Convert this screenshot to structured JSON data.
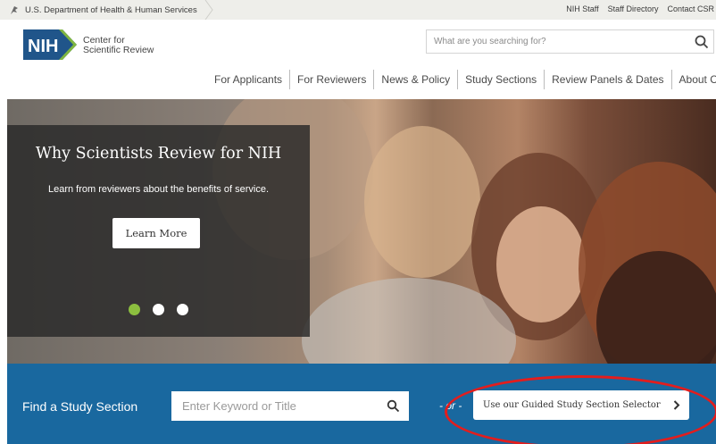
{
  "topbar": {
    "hhs_label": "U.S. Department of Health & Human Services",
    "links": [
      "NIH Staff",
      "Staff Directory",
      "Contact CSR"
    ]
  },
  "header": {
    "logo_text": "NIH",
    "org_line1": "Center for",
    "org_line2": "Scientific Review",
    "search_placeholder": "What are you searching for?"
  },
  "nav": {
    "items": [
      "For Applicants",
      "For Reviewers",
      "News & Policy",
      "Study Sections",
      "Review Panels & Dates",
      "About CSR"
    ]
  },
  "hero": {
    "title": "Why Scientists Review for NIH",
    "subtitle": "Learn from reviewers about the benefits of service.",
    "button_label": "Learn More",
    "carousel_active_slide": 1,
    "carousel_slide_count": 3
  },
  "study": {
    "label": "Find a Study Section",
    "input_placeholder": "Enter Keyword or Title",
    "or_text": "- or -",
    "guided_button_label": "Use our Guided Study Section Selector"
  },
  "colors": {
    "nih_blue": "#20558a",
    "study_bar": "#19689f",
    "active_dot": "#8cbf3f",
    "highlight": "#e31d1d"
  }
}
